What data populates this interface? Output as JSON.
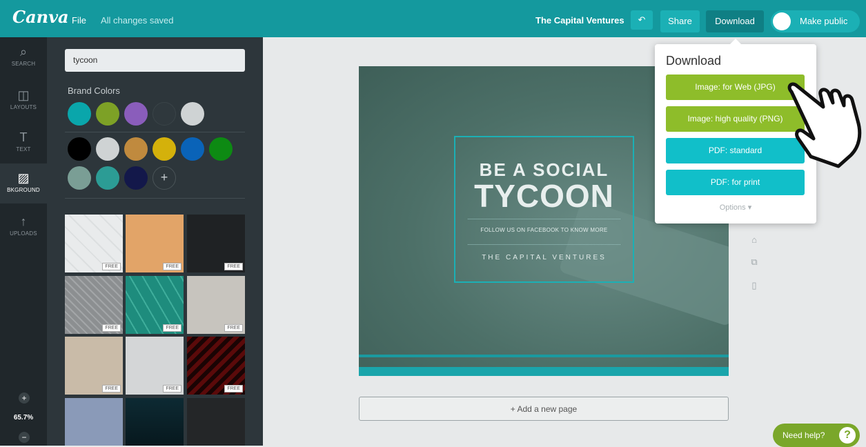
{
  "topbar": {
    "logo": "Canva",
    "file_menu": "File",
    "save_status": "All changes saved",
    "doc_title": "The Capital Ventures",
    "undo_icon": "↶",
    "share_label": "Share",
    "download_label": "Download",
    "public_label": "Make public"
  },
  "leftnav": {
    "items": [
      {
        "label": "SEARCH",
        "icon": "⌕"
      },
      {
        "label": "LAYOUTS",
        "icon": "◫"
      },
      {
        "label": "TEXT",
        "icon": "T"
      },
      {
        "label": "BKGROUND",
        "icon": "▨"
      },
      {
        "label": "UPLOADS",
        "icon": "↑"
      }
    ],
    "zoom_in": "+",
    "zoom_level": "65.7%",
    "zoom_out": "−"
  },
  "panel": {
    "search_value": "tycoon",
    "brand_colors_title": "Brand Colors",
    "brand_colors": [
      "#0aa6ab",
      "#7da126",
      "#8a5dbb",
      "#2f383d",
      "#cfd3d4"
    ],
    "palette_row1": [
      "#000000",
      "#cfd3d4",
      "#c08a3e",
      "#d4b10b",
      "#0a63b8",
      "#0d8a13"
    ],
    "palette_row2": [
      "#7a9e95",
      "#2c9c95",
      "#13184a"
    ],
    "add_color": "+",
    "free_label": "FREE"
  },
  "design": {
    "headline1": "BE A SOCIAL",
    "headline2": "TYCOON",
    "follow": "FOLLOW US ON FACEBOOK TO KNOW MORE",
    "company": "THE CAPITAL VENTURES"
  },
  "add_page": "+ Add a new page",
  "download_menu": {
    "title": "Download",
    "options": [
      "Image: for Web (JPG)",
      "Image: high quality (PNG)",
      "PDF: standard",
      "PDF: for print"
    ],
    "more": "Options ▾"
  },
  "help": {
    "label": "Need help?",
    "icon": "?"
  },
  "colors": {
    "brand": "#14999e",
    "green": "#8ebd2a",
    "teal": "#11bfc9"
  }
}
